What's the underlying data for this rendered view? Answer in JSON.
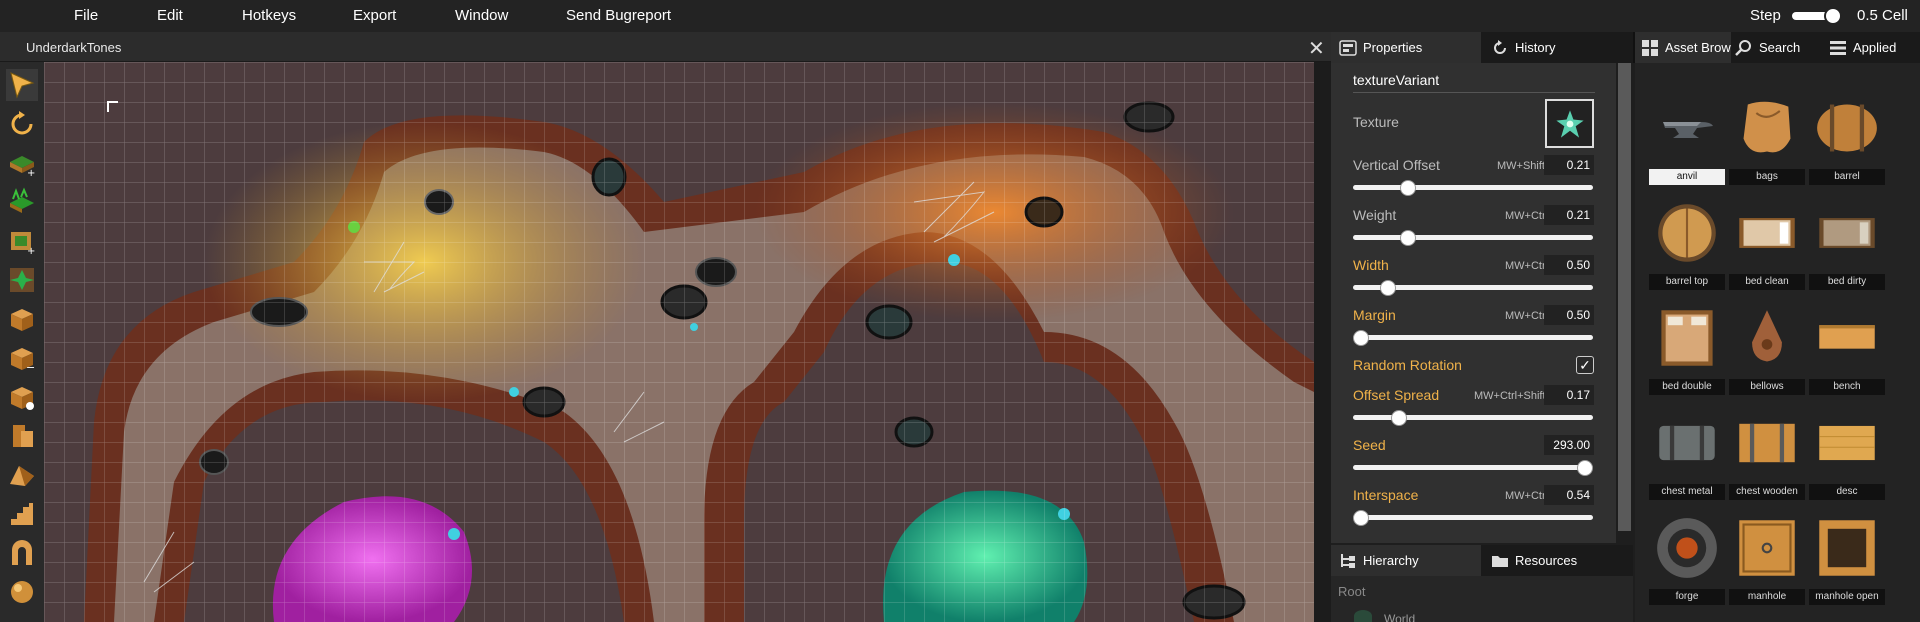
{
  "menu": {
    "items": [
      "File",
      "Edit",
      "Hotkeys",
      "Export",
      "Window",
      "Send Bugreport"
    ],
    "step_label": "Step",
    "step_value": "0.5 Cell"
  },
  "map": {
    "title": "UnderdarkTones",
    "close_glyph": "✕"
  },
  "tools": [
    "select-arrow-icon",
    "rotate-icon",
    "tile-add-icon",
    "grass-add-icon",
    "wall-add-icon",
    "leaf-icon",
    "box-add-icon",
    "box-remove-icon",
    "box-edit-icon",
    "box-stack-icon",
    "prism-icon",
    "stairs-icon",
    "arch-icon",
    "sphere-icon"
  ],
  "properties": {
    "tabs": [
      "Properties",
      "History"
    ],
    "heading": "textureVariant",
    "texture_label": "Texture",
    "check_glyph": "✓",
    "rows": [
      {
        "label": "Vertical Offset",
        "key": "MW+Shift",
        "value": "0.21",
        "fraction": 0.21
      },
      {
        "label": "Weight",
        "key": "MW+Ctrl",
        "value": "0.21",
        "fraction": 0.21
      },
      {
        "label": "Width",
        "key": "MW+Ctrl",
        "value": "0.50",
        "fraction": 0.12
      },
      {
        "label": "Margin",
        "key": "MW+Ctrl",
        "value": "0.50",
        "fraction": 0.0
      },
      {
        "label": "Offset Spread",
        "key": "MW+Ctrl+Shift",
        "value": "0.17",
        "fraction": 0.17
      },
      {
        "label": "Seed",
        "key": "",
        "value": "293.00",
        "fraction": 1.0
      },
      {
        "label": "Interspace",
        "key": "MW+Ctrl",
        "value": "0.54",
        "fraction": 0.0
      }
    ],
    "random_rotation_label": "Random Rotation",
    "random_rotation_checked": true
  },
  "hierarchy": {
    "tabs": [
      "Hierarchy",
      "Resources"
    ],
    "root_label": "Root",
    "world_label": "World"
  },
  "assets": {
    "tabs": [
      "Asset Brows",
      "Search",
      "Applied"
    ],
    "items": [
      "anvil",
      "bags",
      "barrel",
      "barrel top",
      "bed clean",
      "bed dirty",
      "bed double",
      "bellows",
      "bench",
      "chest metal",
      "chest wooden",
      "desc",
      "forge",
      "manhole",
      "manhole open"
    ],
    "selected": "anvil"
  },
  "colors": {
    "accent": "#f0b24a",
    "panel": "#303030",
    "menubar": "#232323"
  }
}
